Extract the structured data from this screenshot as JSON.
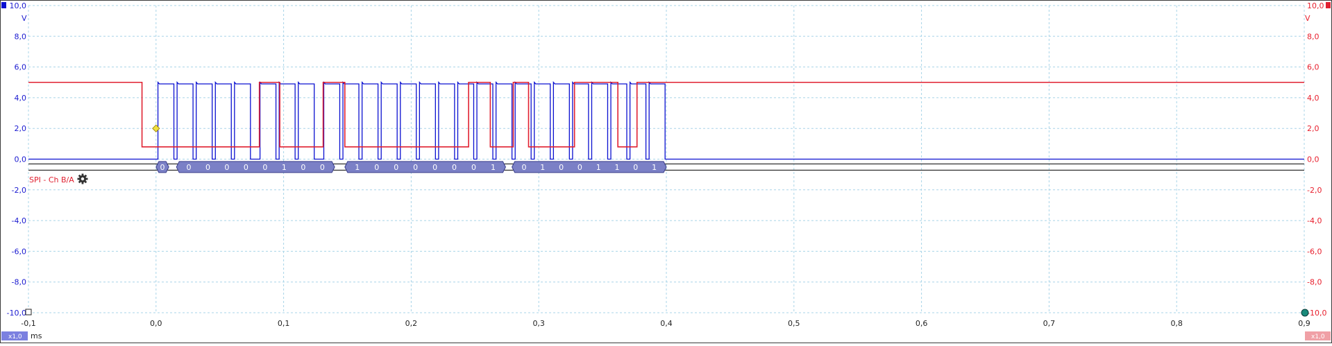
{
  "chart_data": {
    "type": "line",
    "x_unit": "ms",
    "xlim": [
      -0.1,
      0.9
    ],
    "x_ticks": [
      "-0,1",
      "0,0",
      "0,1",
      "0,2",
      "0,3",
      "0,4",
      "0,5",
      "0,6",
      "0,7",
      "0,8",
      "0,9"
    ],
    "x_tick_values": [
      -0.1,
      0.0,
      0.1,
      0.2,
      0.3,
      0.4,
      0.5,
      0.6,
      0.7,
      0.8,
      0.9
    ],
    "ylim": [
      -10,
      10
    ],
    "y_ticks_left": [
      "10,0",
      "8,0",
      "6,0",
      "4,0",
      "2,0",
      "0,0",
      "-2,0",
      "-4,0",
      "-6,0",
      "-8,0",
      "-10,0"
    ],
    "y_ticks_right": [
      "10,0",
      "8,0",
      "6,0",
      "4,0",
      "2,0",
      "0,0",
      "-2,0",
      "-4,0",
      "-6,0",
      "-8,0",
      "-10,0"
    ],
    "y_tick_values": [
      10,
      8,
      6,
      4,
      2,
      0,
      -2,
      -4,
      -6,
      -8,
      -10
    ],
    "y_unit_left": "V",
    "y_unit_right": "V",
    "grid": true,
    "colors": {
      "channel_a": "#0a10d0",
      "channel_b": "#e02030",
      "decoder_fill": "#7b80c6",
      "grid": "#a8d4e8",
      "trigger": "#f0e040"
    },
    "clock": {
      "low": 0.0,
      "high": 5.0,
      "pulse_rise_times": [
        0.0015,
        0.0165,
        0.0315,
        0.0465,
        0.0615,
        0.0815,
        0.0965,
        0.1115,
        0.1315,
        0.1465,
        0.1615,
        0.1765,
        0.1915,
        0.2065,
        0.2215,
        0.2365,
        0.2515,
        0.2665,
        0.2815,
        0.2965,
        0.3115,
        0.3265,
        0.3415,
        0.3565,
        0.3715,
        0.3865
      ],
      "pulse_width": 0.0125,
      "settle_level": 4.9,
      "end_time": 0.4
    },
    "chip_select": {
      "idle_high": 5.0,
      "low": 0.8,
      "high_step": 1.7,
      "points": [
        [
          -0.1,
          5.0
        ],
        [
          -0.011,
          5.0
        ],
        [
          -0.011,
          2.4
        ],
        [
          -0.011,
          0.8
        ],
        [
          0.081,
          0.8
        ],
        [
          0.081,
          5.0
        ],
        [
          0.097,
          5.0
        ],
        [
          0.097,
          0.8
        ],
        [
          0.131,
          0.8
        ],
        [
          0.131,
          5.0
        ],
        [
          0.148,
          5.0
        ],
        [
          0.148,
          0.8
        ],
        [
          0.245,
          0.8
        ],
        [
          0.245,
          5.0
        ],
        [
          0.262,
          5.0
        ],
        [
          0.262,
          0.8
        ],
        [
          0.28,
          0.8
        ],
        [
          0.28,
          5.0
        ],
        [
          0.292,
          5.0
        ],
        [
          0.292,
          0.8
        ],
        [
          0.328,
          0.8
        ],
        [
          0.328,
          5.0
        ],
        [
          0.362,
          5.0
        ],
        [
          0.362,
          0.8
        ],
        [
          0.377,
          0.8
        ],
        [
          0.377,
          5.0
        ],
        [
          0.9,
          5.0
        ]
      ]
    },
    "trigger_marker": {
      "x": 0.0,
      "y": 2.0
    },
    "decoder": {
      "label": "SPI - Ch B/A",
      "level": -0.4,
      "frames": [
        {
          "x0": 0.0,
          "x1": 0.01,
          "bits": [
            "0"
          ]
        },
        {
          "x0": 0.016,
          "x1": 0.14,
          "bits": [
            "0",
            "0",
            "0",
            "0",
            "0",
            "1",
            "0",
            "0"
          ]
        },
        {
          "x0": 0.148,
          "x1": 0.274,
          "bits": [
            "1",
            "0",
            "0",
            "0",
            "0",
            "0",
            "0",
            "1"
          ]
        },
        {
          "x0": 0.279,
          "x1": 0.4,
          "bits": [
            "0",
            "1",
            "0",
            "0",
            "1",
            "1",
            "0",
            "1"
          ]
        }
      ]
    },
    "scale_badge_left": "x1,0",
    "scale_badge_right": "x1,0"
  }
}
